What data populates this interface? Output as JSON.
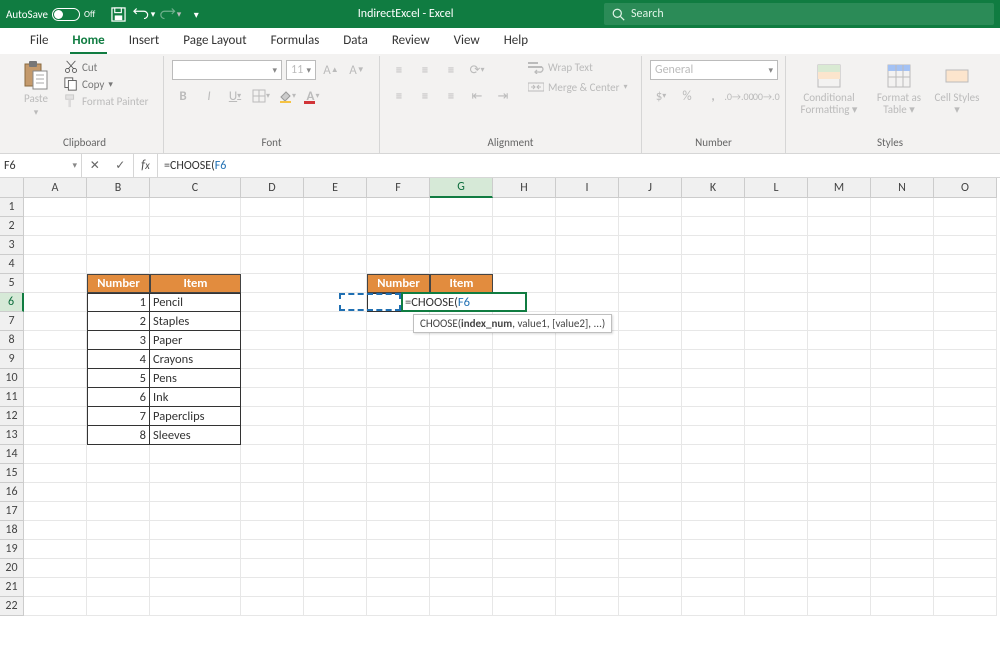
{
  "titlebar": {
    "autosave_label": "AutoSave",
    "autosave_state": "Off",
    "doc_title": "IndirectExcel  -  Excel",
    "search_placeholder": "Search"
  },
  "tabs": [
    "File",
    "Home",
    "Insert",
    "Page Layout",
    "Formulas",
    "Data",
    "Review",
    "View",
    "Help"
  ],
  "active_tab": "Home",
  "ribbon": {
    "clipboard": {
      "paste": "Paste",
      "cut": "Cut",
      "copy": "Copy",
      "format_painter": "Format Painter",
      "label": "Clipboard"
    },
    "font": {
      "font_name": "",
      "font_size": "11",
      "label": "Font"
    },
    "alignment": {
      "wrap": "Wrap Text",
      "merge": "Merge & Center",
      "label": "Alignment"
    },
    "number": {
      "format": "General",
      "label": "Number"
    },
    "styles": {
      "conditional": "Conditional Formatting",
      "table": "Format as Table",
      "cell": "Cell Styles",
      "label": "Styles"
    }
  },
  "formula_bar": {
    "name_box": "F6",
    "formula_prefix": "=CHOOSE(",
    "formula_ref": "F6"
  },
  "columns": [
    "A",
    "B",
    "C",
    "D",
    "E",
    "F",
    "G",
    "H",
    "I",
    "J",
    "K",
    "L",
    "M",
    "N",
    "O"
  ],
  "row_count": 22,
  "table1": {
    "headers": [
      "Number",
      "Item"
    ],
    "rows": [
      {
        "num": "1",
        "item": "Pencil"
      },
      {
        "num": "2",
        "item": "Staples"
      },
      {
        "num": "3",
        "item": "Paper"
      },
      {
        "num": "4",
        "item": "Crayons"
      },
      {
        "num": "5",
        "item": "Pens"
      },
      {
        "num": "6",
        "item": "Ink"
      },
      {
        "num": "7",
        "item": "Paperclips"
      },
      {
        "num": "8",
        "item": "Sleeves"
      }
    ]
  },
  "table2": {
    "headers": [
      "Number",
      "Item"
    ]
  },
  "editing_cell": {
    "display": "=CHOOSE(",
    "ref": "F6"
  },
  "func_tooltip": "CHOOSE(index_num, value1, [value2], ...)",
  "func_tooltip_bold": "index_num"
}
